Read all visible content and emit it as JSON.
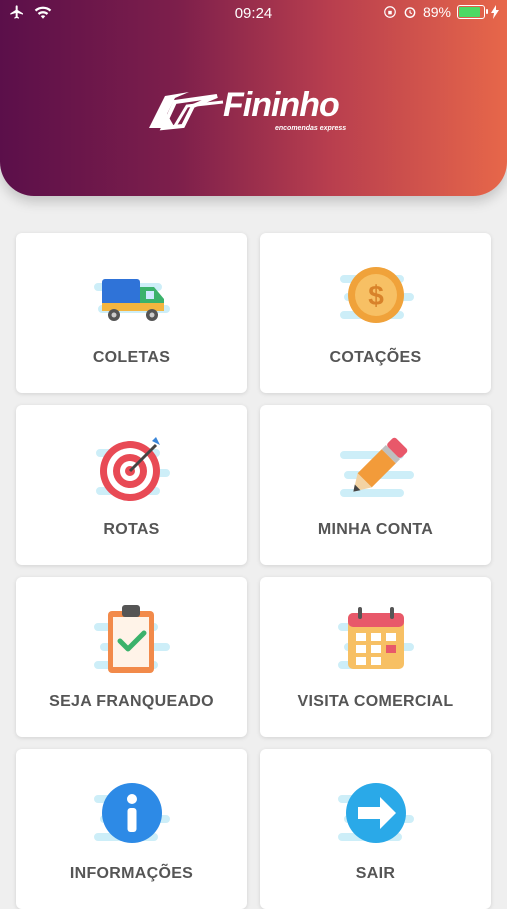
{
  "status_bar": {
    "time": "09:24",
    "battery": "89%"
  },
  "brand": {
    "name": "Fininho",
    "tagline": "encomendas express"
  },
  "menu": [
    {
      "label": "COLETAS",
      "icon": "truck-icon"
    },
    {
      "label": "COTAÇÕES",
      "icon": "coin-icon"
    },
    {
      "label": "ROTAS",
      "icon": "target-icon"
    },
    {
      "label": "MINHA CONTA",
      "icon": "pencil-icon"
    },
    {
      "label": "SEJA FRANQUEADO",
      "icon": "clipboard-check-icon"
    },
    {
      "label": "VISITA COMERCIAL",
      "icon": "calendar-icon"
    },
    {
      "label": "INFORMAÇÕES",
      "icon": "info-icon"
    },
    {
      "label": "SAIR",
      "icon": "exit-arrow-icon"
    }
  ],
  "colors": {
    "header_start": "#5b0f4a",
    "header_end": "#e7674a",
    "label": "#555555",
    "background": "#efefef"
  }
}
